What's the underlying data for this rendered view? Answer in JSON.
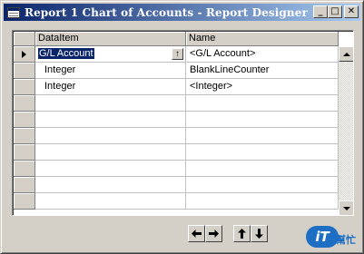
{
  "window": {
    "title": "Report 1 Chart of Accounts - Report Designer",
    "icon": "report-designer-icon",
    "controls": {
      "minimize": "_",
      "maximize": "□",
      "close": "✕"
    }
  },
  "grid": {
    "columns": [
      "DataItem",
      "Name"
    ],
    "rows": [
      {
        "dataitem": "G/L Account",
        "name": "<G/L Account>",
        "current": true,
        "selected": true
      },
      {
        "dataitem": "Integer",
        "name": "BlankLineCounter",
        "current": false,
        "selected": false
      },
      {
        "dataitem": "Integer",
        "name": "<Integer>",
        "current": false,
        "selected": false
      },
      {
        "dataitem": "",
        "name": ""
      },
      {
        "dataitem": "",
        "name": ""
      },
      {
        "dataitem": "",
        "name": ""
      },
      {
        "dataitem": "",
        "name": ""
      },
      {
        "dataitem": "",
        "name": ""
      },
      {
        "dataitem": "",
        "name": ""
      },
      {
        "dataitem": "",
        "name": ""
      }
    ]
  },
  "toolbar": {
    "buttons": [
      "arrow-left-icon",
      "arrow-right-icon",
      "arrow-up-icon",
      "arrow-down-icon"
    ]
  },
  "watermark": {
    "logo": "iT",
    "text": "幫忙"
  },
  "colors": {
    "titlebar_start": "#0a246a",
    "titlebar_end": "#a6caf0",
    "face": "#d4d0c8",
    "selection": "#0a246a"
  }
}
